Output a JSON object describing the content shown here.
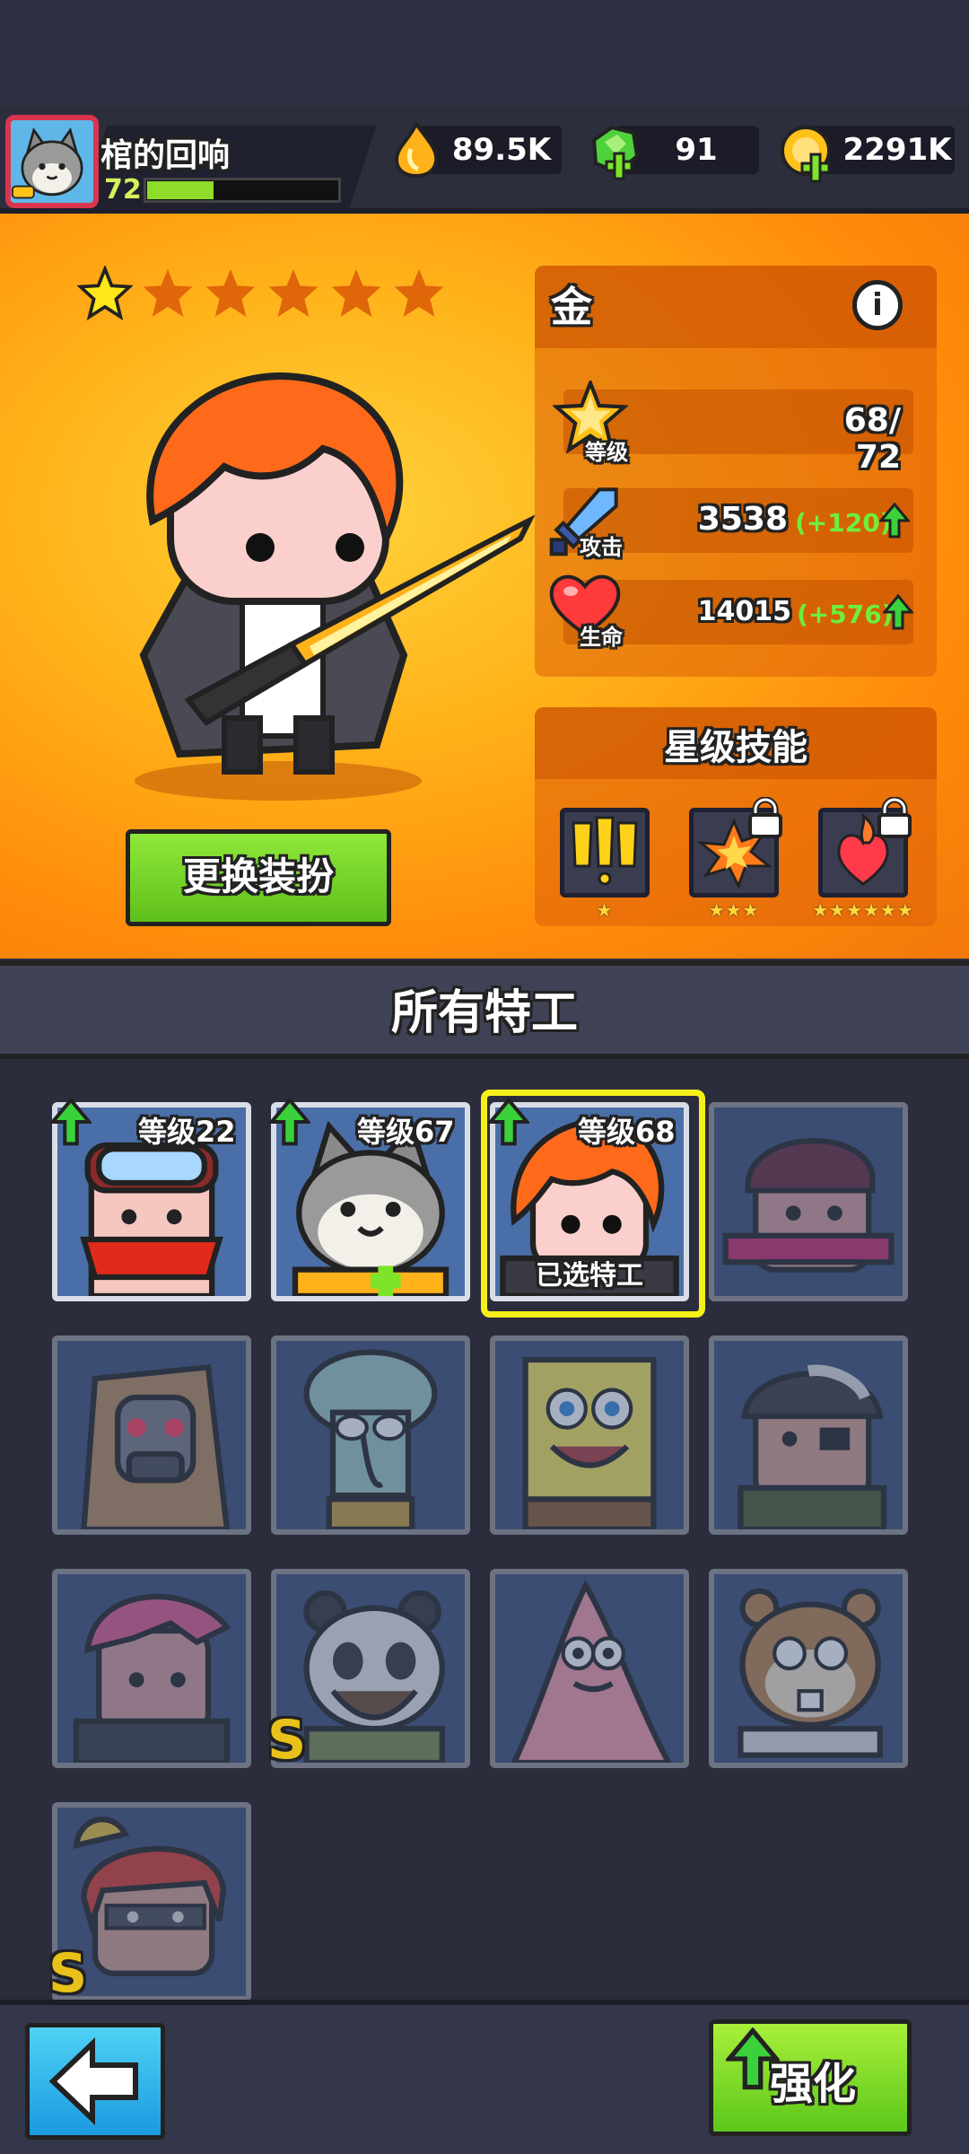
{
  "player": {
    "name": "棺的回响",
    "level": "72",
    "xp_progress": 0.35
  },
  "currencies": [
    {
      "name": "energy",
      "icon": "fire-drop-icon",
      "value": "89.5K"
    },
    {
      "name": "gems",
      "icon": "green-gem-plus-icon",
      "value": "91"
    },
    {
      "name": "coins",
      "icon": "gold-coin-plus-icon",
      "value": "2291K"
    }
  ],
  "hero": {
    "stars_filled": 1,
    "stars_total": 6,
    "rarity": "金",
    "level_label": "等级",
    "level_value": "68/ 72",
    "attack_label": "攻击",
    "attack_value": "3538",
    "attack_bonus": "(+120)",
    "hp_label": "生命",
    "hp_value": "14015",
    "hp_bonus": "(+576)",
    "change_outfit": "更换装扮"
  },
  "skills": {
    "title": "星级技能",
    "items": [
      {
        "icon": "alert-skill-icon",
        "stars": "★",
        "locked": false
      },
      {
        "icon": "explosion-skill-icon",
        "stars": "★★★",
        "locked": true
      },
      {
        "icon": "fire-heart-skill-icon",
        "stars": "★★★★★★",
        "locked": true
      }
    ]
  },
  "agents": {
    "title": "所有特工",
    "selected_label": "已选特工",
    "cards": [
      {
        "name": "goggles-agent",
        "level": "等级22",
        "upgradable": true,
        "locked": false,
        "badge": ""
      },
      {
        "name": "cat-agent",
        "level": "等级67",
        "upgradable": true,
        "locked": false,
        "badge": ""
      },
      {
        "name": "redhair-agent",
        "level": "等级68",
        "upgradable": true,
        "locked": false,
        "selected": true,
        "badge": ""
      },
      {
        "name": "scarf-agent",
        "level": "",
        "upgradable": false,
        "locked": true,
        "badge": ""
      },
      {
        "name": "gasmask-agent",
        "level": "",
        "upgradable": false,
        "locked": true,
        "badge": ""
      },
      {
        "name": "squidward-agent",
        "level": "",
        "upgradable": false,
        "locked": true,
        "badge": ""
      },
      {
        "name": "spongebob-agent",
        "level": "",
        "upgradable": false,
        "locked": true,
        "badge": ""
      },
      {
        "name": "eyepatch-agent",
        "level": "",
        "upgradable": false,
        "locked": true,
        "badge": ""
      },
      {
        "name": "pinkhair-agent",
        "level": "",
        "upgradable": false,
        "locked": true,
        "badge": ""
      },
      {
        "name": "panda-agent",
        "level": "",
        "upgradable": false,
        "locked": true,
        "badge": "S"
      },
      {
        "name": "patrick-agent",
        "level": "",
        "upgradable": false,
        "locked": true,
        "badge": ""
      },
      {
        "name": "sandy-agent",
        "level": "",
        "upgradable": false,
        "locked": true,
        "badge": ""
      },
      {
        "name": "ponytail-agent",
        "level": "",
        "upgradable": false,
        "locked": true,
        "badge": "S"
      }
    ]
  },
  "bottom": {
    "upgrade": "强化"
  },
  "colors": {
    "accent_green": "#8fdc2a",
    "selected_yellow": "#f6f01a",
    "bonus_green": "#6cf03a",
    "hero_orange": "#ff8c0a"
  }
}
